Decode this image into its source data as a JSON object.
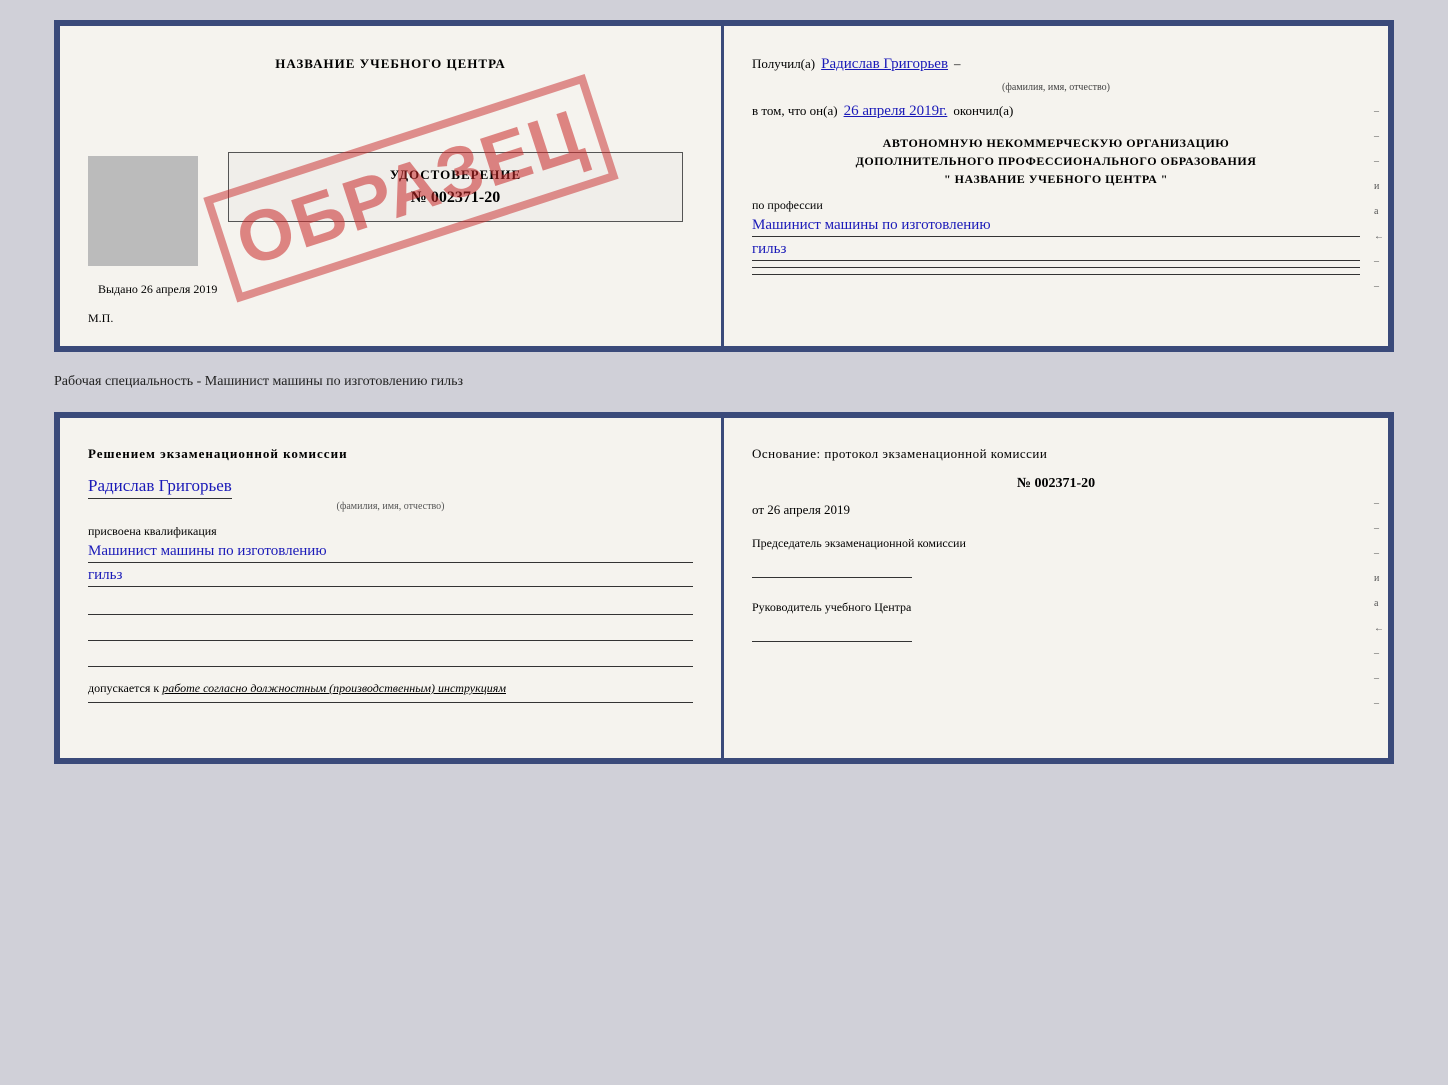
{
  "top_left": {
    "title": "НАЗВАНИЕ УЧЕБНОГО ЦЕНТРА",
    "cert_title": "УДОСТОВЕРЕНИЕ",
    "cert_number": "№ 002371-20",
    "cert_issued": "Выдано  26 апреля 2019",
    "mp_label": "М.П.",
    "stamp_text": "ОБРАЗЕЦ"
  },
  "top_right": {
    "received_label": "Получил(а)",
    "recipient_name": "Радислав Григорьев",
    "name_hint": "(фамилия, имя, отчество)",
    "date_label": "в том, что он(а)",
    "date_value": "26 апреля 2019г.",
    "finished_label": "окончил(а)",
    "org_title_line1": "АВТОНОМНУЮ НЕКОММЕРЧЕСКУЮ ОРГАНИЗАЦИЮ",
    "org_title_line2": "ДОПОЛНИТЕЛЬНОГО ПРОФЕССИОНАЛЬНОГО ОБРАЗОВАНИЯ",
    "org_name": "\"    НАЗВАНИЕ УЧЕБНОГО ЦЕНТРА    \"",
    "profession_label": "по профессии",
    "profession_value": "Машинист машины по изготовлению",
    "profession_value2": "гильз",
    "side_marks": [
      "–",
      "–",
      "–",
      "и",
      "а",
      "←",
      "–",
      "–"
    ]
  },
  "middle_label": "Рабочая специальность - Машинист машины по изготовлению гильз",
  "bottom_left": {
    "decision_title": "Решением  экзаменационной  комиссии",
    "person_name": "Радислав Григорьев",
    "name_hint": "(фамилия, имя, отчество)",
    "qualification_label": "присвоена квалификация",
    "qualification_value": "Машинист машины по изготовлению",
    "qualification_value2": "гильз",
    "allow_label": "допускается к",
    "allow_value": "работе согласно должностным (производственным) инструкциям"
  },
  "bottom_right": {
    "basis_title": "Основание: протокол экзаменационной  комиссии",
    "protocol_number": "№  002371-20",
    "date_prefix": "от",
    "date_value": "26 апреля 2019",
    "chairman_role": "Председатель экзаменационной комиссии",
    "director_role": "Руководитель учебного Центра",
    "side_marks": [
      "–",
      "–",
      "–",
      "и",
      "а",
      "←",
      "–",
      "–",
      "–"
    ]
  }
}
